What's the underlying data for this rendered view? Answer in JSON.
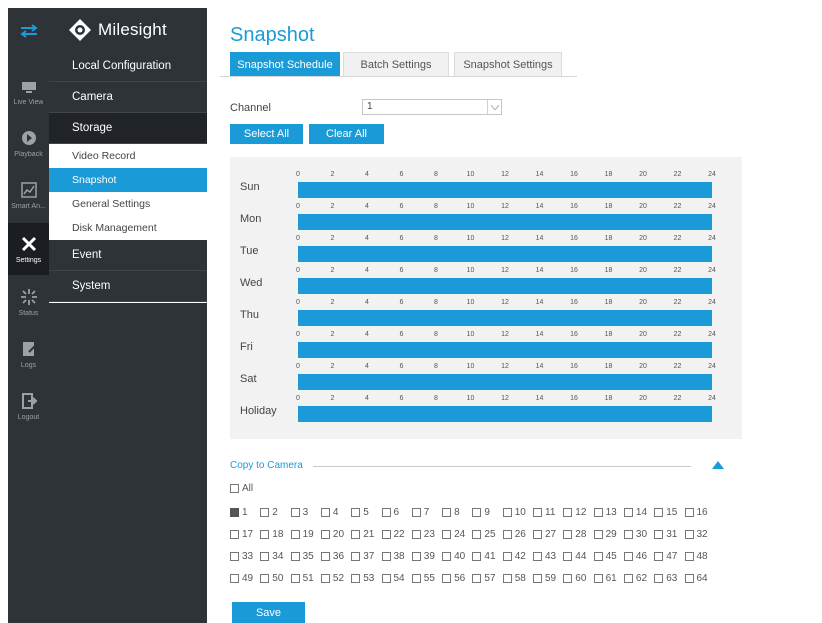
{
  "sidebar": {
    "items": [
      {
        "label": "Live View",
        "icon": "monitor-icon"
      },
      {
        "label": "Playback",
        "icon": "playback-icon"
      },
      {
        "label": "Smart An...",
        "icon": "smart-analytics-icon"
      },
      {
        "label": "Settings",
        "icon": "tools-icon"
      },
      {
        "label": "Status",
        "icon": "status-icon"
      },
      {
        "label": "Logs",
        "icon": "logs-icon"
      },
      {
        "label": "Logout",
        "icon": "logout-icon"
      }
    ],
    "active": "Settings"
  },
  "menu": {
    "brand": "Milesight",
    "items": [
      "Local Configuration",
      "Camera",
      "Storage",
      "Event",
      "System"
    ],
    "storage_sub": [
      "Video Record",
      "Snapshot",
      "General Settings",
      "Disk Management"
    ],
    "active_sub": "Snapshot"
  },
  "page": {
    "title": "Snapshot",
    "tabs": [
      "Snapshot Schedule",
      "Batch Settings",
      "Snapshot Settings"
    ],
    "active_tab": "Snapshot Schedule"
  },
  "channel": {
    "label": "Channel",
    "value": "1"
  },
  "buttons": {
    "select_all": "Select All",
    "clear_all": "Clear All",
    "save": "Save"
  },
  "schedule": {
    "hour_ticks": [
      "0",
      "2",
      "4",
      "6",
      "8",
      "10",
      "12",
      "14",
      "16",
      "18",
      "20",
      "22",
      "24"
    ],
    "days": [
      "Sun",
      "Mon",
      "Tue",
      "Wed",
      "Thu",
      "Fri",
      "Sat",
      "Holiday"
    ],
    "coverage": 1.0,
    "bar_color": "#1a9bd7"
  },
  "copy_to_camera": {
    "title": "Copy to Camera",
    "all_label": "All",
    "all_checked": false,
    "cameras": [
      "1",
      "2",
      "3",
      "4",
      "5",
      "6",
      "7",
      "8",
      "9",
      "10",
      "11",
      "12",
      "13",
      "14",
      "15",
      "16",
      "17",
      "18",
      "19",
      "20",
      "21",
      "22",
      "23",
      "24",
      "25",
      "26",
      "27",
      "28",
      "29",
      "30",
      "31",
      "32",
      "33",
      "34",
      "35",
      "36",
      "37",
      "38",
      "39",
      "40",
      "41",
      "42",
      "43",
      "44",
      "45",
      "46",
      "47",
      "48",
      "49",
      "50",
      "51",
      "52",
      "53",
      "54",
      "55",
      "56",
      "57",
      "58",
      "59",
      "60",
      "61",
      "62",
      "63",
      "64"
    ],
    "checked": [
      "1"
    ]
  },
  "colors": {
    "accent": "#1a9bd7",
    "sidebar_bg": "#2e3338"
  }
}
